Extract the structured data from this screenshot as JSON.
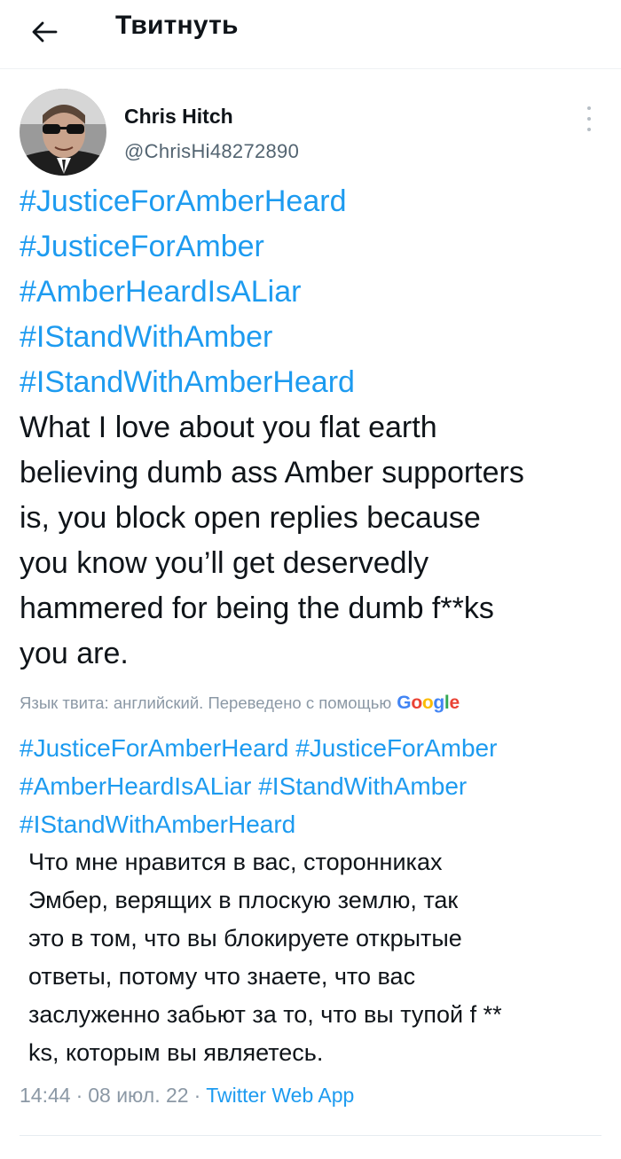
{
  "header": {
    "title": "Твитнуть",
    "back_icon": "arrow-left-icon"
  },
  "tweet": {
    "author": {
      "name": "Chris Hitch",
      "handle": "@ChrisHi48272890"
    },
    "hashtags": [
      "#JusticeForAmberHeard",
      "#JusticeForAmber",
      "#AmberHeardIsALiar",
      "#IStandWithAmber",
      "#IStandWithAmberHeard"
    ],
    "text": "What I love about you flat earth\nbelieving dumb ass Amber supporters\nis, you block open replies because\nyou know you’ll get deservedly\nhammered for being the dumb f**ks\nyou are.",
    "translation": {
      "note": "Язык твита: английский. Переведено с помощью",
      "provider": "Google",
      "hashtags": [
        "#JusticeForAmberHeard",
        "#JusticeForAmber",
        "#AmberHeardIsALiar",
        "#IStandWithAmber",
        "#IStandWithAmberHeard"
      ],
      "text": "Что мне нравится в вас, сторонниках\nЭмбер, верящих в плоскую землю, так\nэто в том, что вы блокируете открытые\nответы, потому что знаете, что вас\nзаслуженно забьют за то, что вы тупой f **\nks, которым вы являетесь."
    },
    "time": "14:44",
    "date": "08 июл. 22",
    "separator": "·",
    "source": "Twitter Web App"
  },
  "colors": {
    "link": "#1d9bf0",
    "muted": "#8b98a5",
    "text": "#0f1419"
  }
}
